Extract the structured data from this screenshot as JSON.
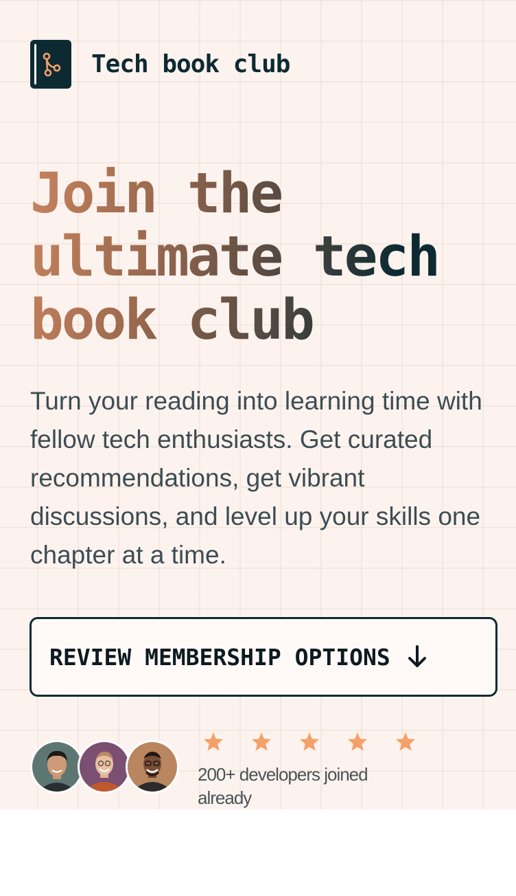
{
  "brand": {
    "name": "Tech book club",
    "icon": "book-branch-icon",
    "colors": {
      "dark": "#0d2a33",
      "accent": "#f5a06a"
    }
  },
  "hero": {
    "headline_lines": [
      "Join the",
      "ultimate tech",
      "book club"
    ],
    "subtitle": "Turn your reading into learning time with fellow tech enthusiasts. Get curated recommendations, get vibrant discussions, and level up your skills one chapter at a time."
  },
  "cta": {
    "label": "REVIEW MEMBERSHIP OPTIONS",
    "icon": "arrow-down-icon"
  },
  "social_proof": {
    "avatars": [
      "avatar-1",
      "avatar-2",
      "avatar-3"
    ],
    "rating_stars": 5,
    "text": "200+ developers joined already"
  }
}
